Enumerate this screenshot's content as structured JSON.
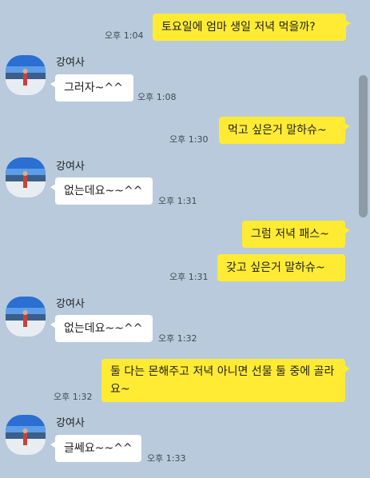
{
  "contact": {
    "name": "강여사"
  },
  "messages": [
    {
      "dir": "out",
      "text": "토요일에 엄마 생일 저녁 먹을까?",
      "time": "오후 1:04"
    },
    {
      "dir": "in",
      "text": "그러자~^^",
      "time": "오후 1:08"
    },
    {
      "dir": "out",
      "text": "먹고 싶은거 말하슈~",
      "time": "오후 1:30"
    },
    {
      "dir": "in",
      "text": "없는데요~~^^",
      "time": "오후 1:31"
    },
    {
      "dir": "out",
      "text": "그럼 저녁 패스~",
      "time": ""
    },
    {
      "dir": "out",
      "text": "갖고 싶은거 말하슈~",
      "time": "오후 1:31"
    },
    {
      "dir": "in",
      "text": "없는데요~~^^",
      "time": "오후 1:32"
    },
    {
      "dir": "out",
      "text": "둘 다는 몬해주고 저녁 아니면 선물 둘 중에 골라요~",
      "time": "오후 1:32"
    },
    {
      "dir": "in",
      "text": "글쎄요~~^^",
      "time": "오후 1:33"
    }
  ],
  "colors": {
    "background": "#b9cadc",
    "outgoing_bubble": "#ffeb33",
    "incoming_bubble": "#ffffff"
  }
}
